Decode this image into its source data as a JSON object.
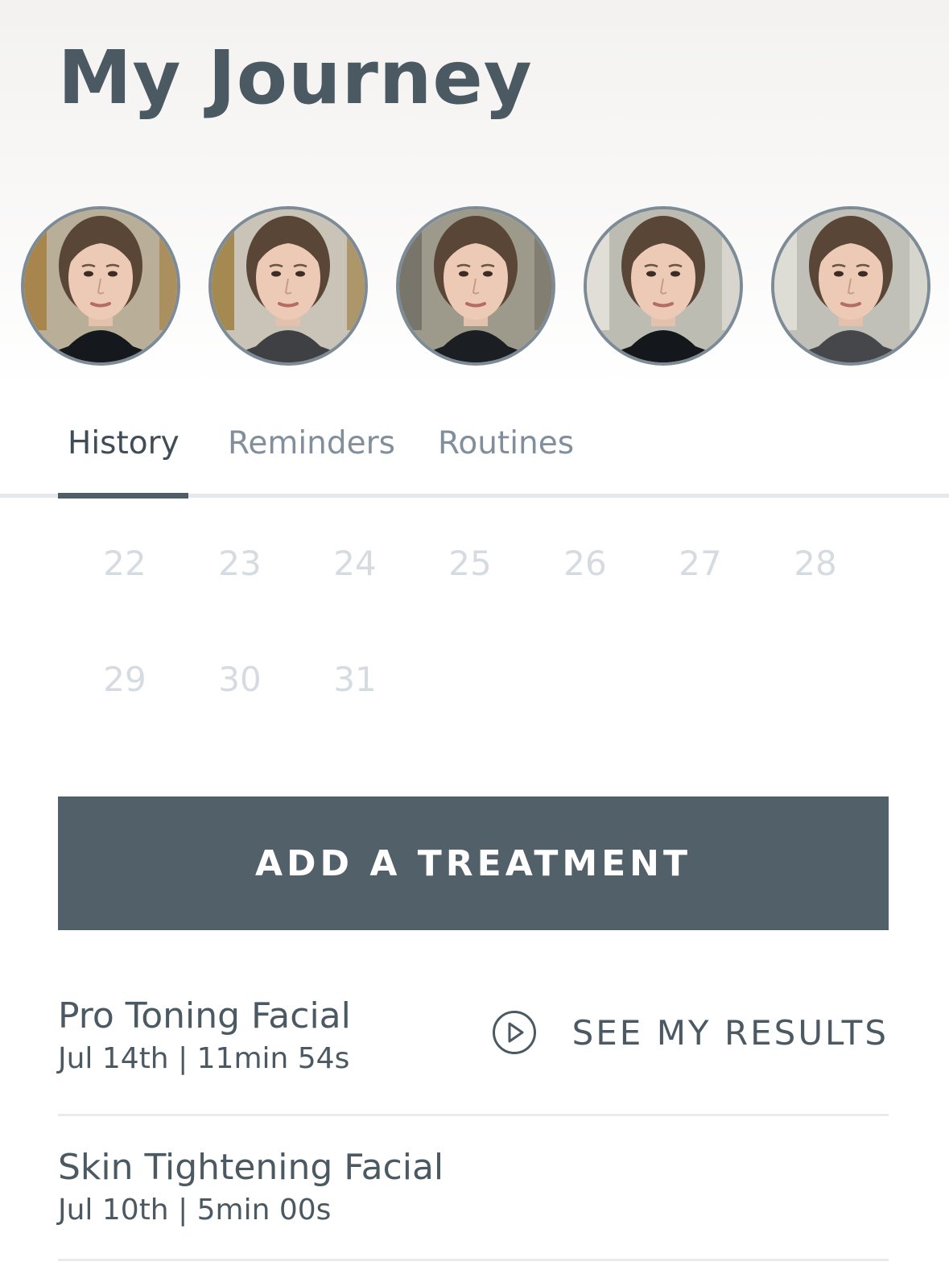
{
  "header": {
    "title": "My Journey"
  },
  "photos": [
    {
      "name": "progress-photo",
      "shirt": "#15191e",
      "bg": "#b9ae97",
      "accent": "#a27a3a"
    },
    {
      "name": "progress-photo",
      "shirt": "#3e4044",
      "bg": "#c9c4b7",
      "accent": "#9b7a37"
    },
    {
      "name": "progress-photo",
      "shirt": "#1b1e22",
      "bg": "#9d9a8b",
      "accent": "#6f6c61"
    },
    {
      "name": "progress-photo",
      "shirt": "#14171b",
      "bg": "#bdbcb2",
      "accent": "#e8e6df"
    },
    {
      "name": "progress-photo",
      "shirt": "#46474a",
      "bg": "#c0c0b8",
      "accent": "#e5e3dc"
    }
  ],
  "tabs": {
    "history": "History",
    "reminders": "Reminders",
    "routines": "Routines",
    "active": "History"
  },
  "calendar": {
    "week1": [
      "22",
      "23",
      "24",
      "25",
      "26",
      "27",
      "28"
    ],
    "week2": [
      "29",
      "30",
      "31"
    ]
  },
  "add_button": {
    "label": "ADD A TREATMENT"
  },
  "treatments": [
    {
      "name": "Pro Toning Facial",
      "meta": "Jul 14th | 11min 54s",
      "action": "SEE MY RESULTS"
    },
    {
      "name": "Skin Tightening Facial",
      "meta": "Jul 10th | 5min 00s"
    }
  ],
  "colors": {
    "primary": "#52606a",
    "text": "#4b5963",
    "muted": "#808f9b",
    "calendar_day": "#d5dbe0",
    "divider": "#e8eaec"
  }
}
